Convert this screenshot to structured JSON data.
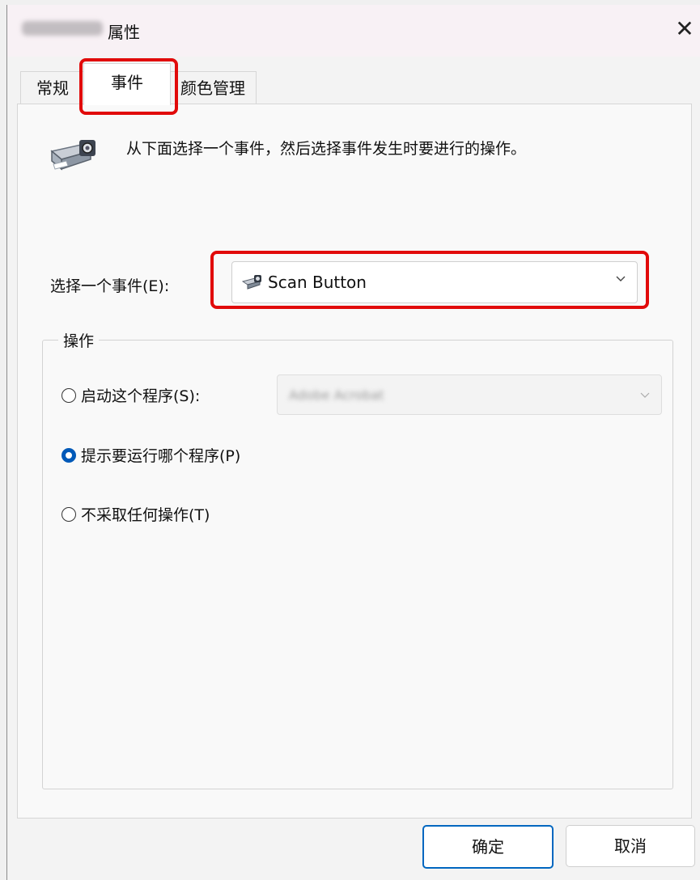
{
  "window": {
    "title": "属性",
    "close_glyph": "✕"
  },
  "tabs": [
    {
      "label": "常规"
    },
    {
      "label": "事件"
    },
    {
      "label": "颜色管理"
    }
  ],
  "description": "从下面选择一个事件，然后选择事件发生时要进行的操作。",
  "event_select": {
    "label": "选择一个事件(E):",
    "value": "Scan Button"
  },
  "actions": {
    "group_title": "操作",
    "options": [
      {
        "label": "启动这个程序(S):",
        "checked": false
      },
      {
        "label": "提示要运行哪个程序(P)",
        "checked": true
      },
      {
        "label": "不采取任何操作(T)",
        "checked": false
      }
    ],
    "program_value": "Adobe Acrobat"
  },
  "buttons": {
    "ok": "确定",
    "cancel": "取消"
  },
  "colors": {
    "highlight": "#e10a0a",
    "accent": "#0067c0"
  },
  "icons": [
    "close-icon",
    "scanner-icon",
    "chevron-down-icon"
  ]
}
